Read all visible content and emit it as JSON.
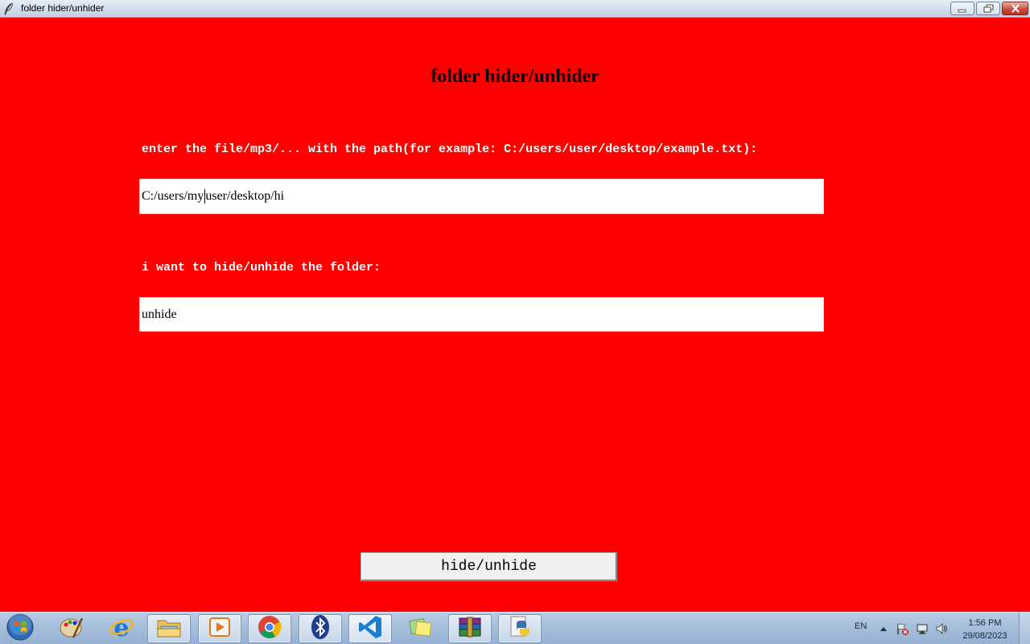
{
  "window": {
    "title": "folder hider/unhider",
    "controls": {
      "minimize": "minimize-icon",
      "maximize": "restore-icon",
      "close": "close-icon"
    }
  },
  "app": {
    "heading": "folder hider/unhider",
    "path_label": "enter the file/mp3/... with the path(for example: C:/users/user/desktop/example.txt):",
    "path_value_before_caret": "C:/users/my ",
    "path_value_after_caret": "user/desktop/hi",
    "mode_label": "i want to hide/unhide the folder:",
    "mode_value": "unhide",
    "action_button": "hide/unhide",
    "colors": {
      "background": "#ff0000",
      "label": "#ffffff",
      "field": "#ffffff"
    }
  },
  "taskbar": {
    "start_icon": "windows-start-icon",
    "items": [
      {
        "name": "paint-icon",
        "open": false
      },
      {
        "name": "internet-explorer-icon",
        "open": false
      },
      {
        "name": "file-explorer-icon",
        "open": true
      },
      {
        "name": "media-player-icon",
        "open": true
      },
      {
        "name": "chrome-icon",
        "open": true
      },
      {
        "name": "bluetooth-icon",
        "open": true
      },
      {
        "name": "vscode-icon",
        "open": true
      },
      {
        "name": "sticky-notes-icon",
        "open": false
      },
      {
        "name": "winrar-icon",
        "open": true
      },
      {
        "name": "python-icon",
        "open": true
      }
    ],
    "tray": {
      "language": "EN",
      "icons": [
        "show-hidden-icons",
        "action-center-flag-icon",
        "network-icon",
        "volume-icon"
      ]
    },
    "clock": {
      "time": "1:56 PM",
      "date": "29/08/2023"
    }
  }
}
